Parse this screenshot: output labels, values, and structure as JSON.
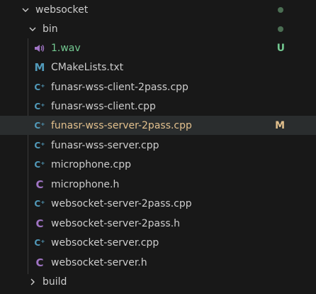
{
  "tree": {
    "root_folder": {
      "label": "websocket",
      "expanded": true
    },
    "bin_folder": {
      "label": "bin",
      "expanded": true
    },
    "files": [
      {
        "label": "1.wav",
        "type": "audio",
        "git_status": "U",
        "status_color": "#73c991"
      },
      {
        "label": "CMakeLists.txt",
        "type": "cmake",
        "git_status": "",
        "status_color": ""
      },
      {
        "label": "funasr-wss-client-2pass.cpp",
        "type": "cpp",
        "git_status": "",
        "status_color": ""
      },
      {
        "label": "funasr-wss-client.cpp",
        "type": "cpp",
        "git_status": "",
        "status_color": ""
      },
      {
        "label": "funasr-wss-server-2pass.cpp",
        "type": "cpp",
        "git_status": "M",
        "status_color": "#e2c08d",
        "selected": true
      },
      {
        "label": "funasr-wss-server.cpp",
        "type": "cpp",
        "git_status": "",
        "status_color": ""
      },
      {
        "label": "microphone.cpp",
        "type": "cpp",
        "git_status": "",
        "status_color": ""
      },
      {
        "label": "microphone.h",
        "type": "c-header",
        "git_status": "",
        "status_color": ""
      },
      {
        "label": "websocket-server-2pass.cpp",
        "type": "cpp",
        "git_status": "",
        "status_color": ""
      },
      {
        "label": "websocket-server-2pass.h",
        "type": "c-header",
        "git_status": "",
        "status_color": ""
      },
      {
        "label": "websocket-server.cpp",
        "type": "cpp",
        "git_status": "",
        "status_color": ""
      },
      {
        "label": "websocket-server.h",
        "type": "c-header",
        "git_status": "",
        "status_color": ""
      }
    ],
    "build_folder": {
      "label": "build",
      "expanded": false
    },
    "icons": {
      "cpp": "C⁺",
      "c-header": "C",
      "cmake": "M"
    },
    "colors": {
      "untracked": "#73c991",
      "modified": "#e2c08d",
      "folder_dot": "#4b6e53",
      "selection": "#2a2d2e"
    }
  }
}
